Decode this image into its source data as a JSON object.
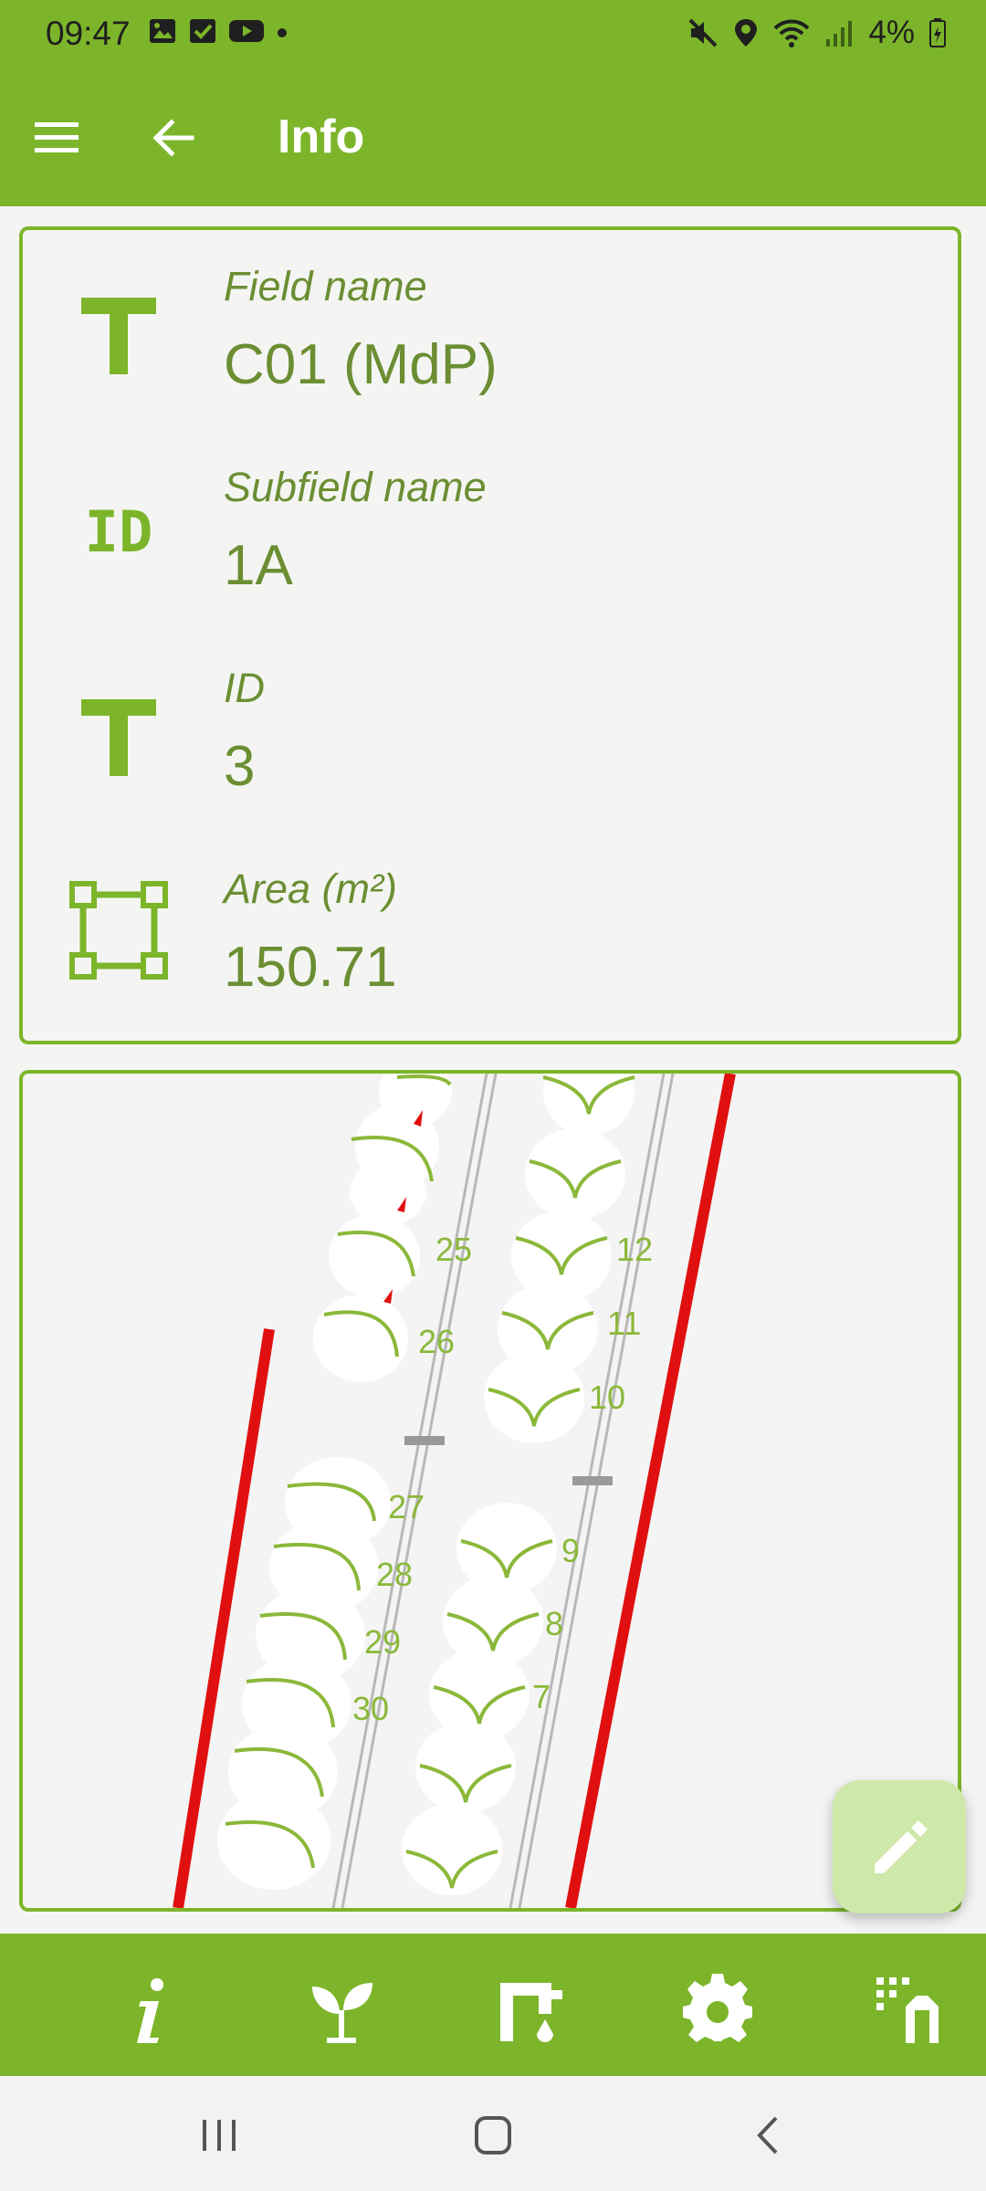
{
  "status_bar": {
    "time": "09:47",
    "battery": "4%",
    "left_icons": [
      "gallery-icon",
      "checkbox-icon",
      "youtube-icon",
      "dot-icon"
    ],
    "right_icons": [
      "mute-icon",
      "location-icon",
      "wifi-icon",
      "signal-icon",
      "battery-icon"
    ]
  },
  "app_bar": {
    "title": "Info",
    "menu_icon": "menu-icon",
    "back_icon": "back-arrow-icon"
  },
  "info": {
    "rows": [
      {
        "icon": "text-icon",
        "label": "Field name",
        "value": "C01 (MdP)"
      },
      {
        "icon": "id-icon",
        "label": "Subfield name",
        "value": "1A"
      },
      {
        "icon": "text-icon",
        "label": "ID",
        "value": "3"
      },
      {
        "icon": "area-icon",
        "label": "Area (m²)",
        "value": "150.71"
      }
    ]
  },
  "map": {
    "row_numbers_left": [
      "25",
      "26",
      "27",
      "28",
      "29",
      "30"
    ],
    "row_numbers_right": [
      "12",
      "11",
      "10",
      "9",
      "8",
      "7"
    ],
    "colors": {
      "boundary": "#e01010",
      "plant": "#8bb83a",
      "row_line": "#b8b8b8"
    }
  },
  "fab": {
    "icon": "edit-pencil-icon"
  },
  "bottom_nav": {
    "items": [
      "info-icon",
      "plant-icon",
      "irrigation-icon",
      "settings-icon",
      "export-icon"
    ]
  },
  "system_nav": {
    "items": [
      "recents-icon",
      "home-icon",
      "back-icon"
    ]
  },
  "theme": {
    "primary": "#7cb52a",
    "text_green": "#6b8e33",
    "fab_bg": "#cde8a8"
  }
}
